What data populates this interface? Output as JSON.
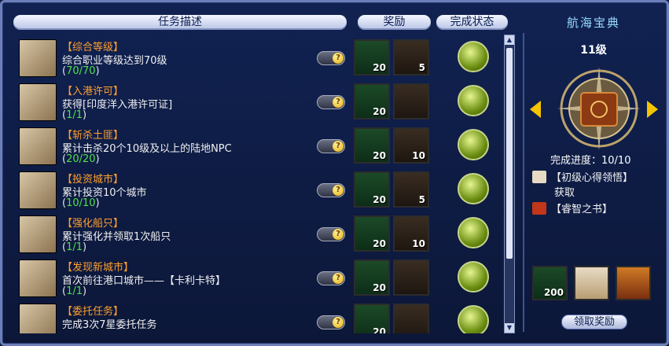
{
  "headers": {
    "task": "任务描述",
    "reward": "奖励",
    "status": "完成状态"
  },
  "tasks": [
    {
      "title": "【综合等级】",
      "desc": "综合职业等级达到70级",
      "progress": "70/70",
      "reward_a": "20",
      "reward_b": "5",
      "icon": "telescope-icon",
      "reward_b_icon": "scroll-book-icon"
    },
    {
      "title": "【入港许可】",
      "desc": "获得[印度洋入港许可证]",
      "progress": "1/1",
      "reward_a": "20",
      "reward_b": "",
      "icon": "swords-shield-icon",
      "reward_b_icon": "red-book-icon"
    },
    {
      "title": "【斩杀土匪】",
      "desc": "累计击杀20个10级及以上的陆地NPC",
      "progress": "20/20",
      "reward_a": "20",
      "reward_b": "10",
      "icon": "telescope-icon",
      "reward_b_icon": "bandit-icon"
    },
    {
      "title": "【投资城市】",
      "desc": "累计投资10个城市",
      "progress": "10/10",
      "reward_a": "20",
      "reward_b": "5",
      "icon": "goods-icon",
      "reward_b_icon": "spindle-icon"
    },
    {
      "title": "【强化船只】",
      "desc": "累计强化并领取1次船只",
      "progress": "1/1",
      "reward_a": "20",
      "reward_b": "10",
      "icon": "telescope-icon",
      "reward_b_icon": "manual-icon"
    },
    {
      "title": "【发现新城市】",
      "desc": "首次前往港口城市——【卡利卡特】",
      "progress": "1/1",
      "reward_a": "20",
      "reward_b": "",
      "icon": "telescope-icon",
      "reward_b_icon": "book-icon"
    },
    {
      "title": "【委托任务】",
      "desc": "完成3次7星委托任务",
      "progress": "",
      "reward_a": "20",
      "reward_b": "",
      "icon": "telescope-icon",
      "reward_b_icon": "exp-scroll-icon"
    }
  ],
  "panel": {
    "title": "航海宝典",
    "level": "11级",
    "progress_label": "完成进度：10/10",
    "rewards": [
      {
        "label": "【初级心得领悟】",
        "icon": "scroll-icon"
      },
      {
        "label": "获取",
        "icon": ""
      },
      {
        "label": "【睿智之书】",
        "icon": "book-icon"
      }
    ],
    "big_rewards": [
      {
        "icon": "diamond-icon",
        "count": "200"
      },
      {
        "icon": "manual-icon",
        "count": ""
      },
      {
        "icon": "exp-scroll-icon",
        "count": ""
      }
    ],
    "claim_label": "领取奖励"
  },
  "colors": {
    "title": "#ff9f2f",
    "progress": "#4de04d",
    "panel_title": "#9adcff",
    "arrow": "#f5c400"
  }
}
